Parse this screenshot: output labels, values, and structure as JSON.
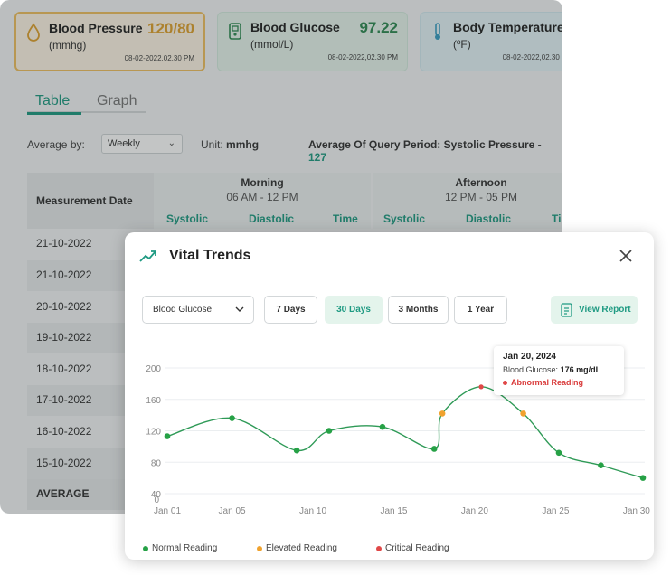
{
  "cards": [
    {
      "title": "Blood Pressure",
      "unit": "(mmhg)",
      "value": "120/80",
      "date": "08-02-2022,02.30 PM"
    },
    {
      "title": "Blood Glucose",
      "unit": "(mmol/L)",
      "value": "97.22",
      "date": "08-02-2022,02.30 PM"
    },
    {
      "title": "Body Temperature",
      "unit": "(ºF)",
      "value": "",
      "date": "08-02-2022,02.30 PM"
    }
  ],
  "tabs": {
    "table": "Table",
    "graph": "Graph"
  },
  "filters": {
    "average_by_label": "Average by:",
    "average_by_value": "Weekly",
    "unit_label": "Unit:",
    "unit_value": "mmhg",
    "query_label": "Average Of Query Period:  Systolic Pressure - ",
    "query_value": "127"
  },
  "table": {
    "date_header": "Measurement Date",
    "groups": [
      {
        "name": "Morning",
        "range": "06 AM - 12 PM",
        "cols": [
          "Systolic",
          "Diastolic",
          "Time"
        ]
      },
      {
        "name": "Afternoon",
        "range": "12 PM - 05 PM",
        "cols": [
          "Systolic",
          "Diastolic",
          "Ti"
        ]
      }
    ],
    "rows": [
      "21-10-2022",
      "21-10-2022",
      "20-10-2022",
      "19-10-2022",
      "18-10-2022",
      "17-10-2022",
      "16-10-2022",
      "15-10-2022"
    ],
    "average_label": "AVERAGE"
  },
  "modal": {
    "title": "Vital Trends",
    "metric_select": "Blood Glucose",
    "ranges": [
      "7 Days",
      "30 Days",
      "3 Months",
      "1 Year"
    ],
    "active_range": "30 Days",
    "view_report": "View Report"
  },
  "tooltip": {
    "date": "Jan 20, 2024",
    "label": "Blood Glucose:",
    "value": "176 mg/dL",
    "status": "Abnormal Reading"
  },
  "colors": {
    "accent": "#1e9a82",
    "normal": "#26a146",
    "elevated": "#f0a22e",
    "critical": "#e04848",
    "line": "#2f9a57"
  },
  "chart_data": {
    "type": "line",
    "title": "",
    "xlabel": "",
    "ylabel": "",
    "ylim": [
      0,
      200
    ],
    "yticks": [
      0,
      40,
      80,
      120,
      160,
      200
    ],
    "xtick_labels": [
      "Jan 01",
      "Jan 05",
      "Jan 10",
      "Jan 15",
      "Jan 20",
      "Jan 25",
      "Jan 30"
    ],
    "xtick_days": [
      1,
      5,
      10,
      15,
      20,
      25,
      30
    ],
    "series": [
      {
        "name": "Blood Glucose",
        "points": [
          {
            "day": 1,
            "value": 113,
            "status": "normal"
          },
          {
            "day": 5,
            "value": 136,
            "status": "normal"
          },
          {
            "day": 9,
            "value": 95,
            "status": "normal"
          },
          {
            "day": 11,
            "value": 120,
            "status": "normal"
          },
          {
            "day": 14.3,
            "value": 125,
            "status": "normal"
          },
          {
            "day": 17.5,
            "value": 97,
            "status": "normal"
          },
          {
            "day": 18,
            "value": 142,
            "status": "elevated"
          },
          {
            "day": 20.4,
            "value": 176,
            "status": "critical"
          },
          {
            "day": 23,
            "value": 142,
            "status": "elevated"
          },
          {
            "day": 25.2,
            "value": 92,
            "status": "normal"
          },
          {
            "day": 27.8,
            "value": 76,
            "status": "normal"
          },
          {
            "day": 30.4,
            "value": 60,
            "status": "normal"
          }
        ]
      }
    ],
    "legend": [
      {
        "label": "Normal Reading",
        "color": "#26a146"
      },
      {
        "label": "Elevated Reading",
        "color": "#f0a22e"
      },
      {
        "label": "Critical Reading",
        "color": "#e04848"
      }
    ],
    "legend_position": "bottom-left",
    "grid": true
  }
}
